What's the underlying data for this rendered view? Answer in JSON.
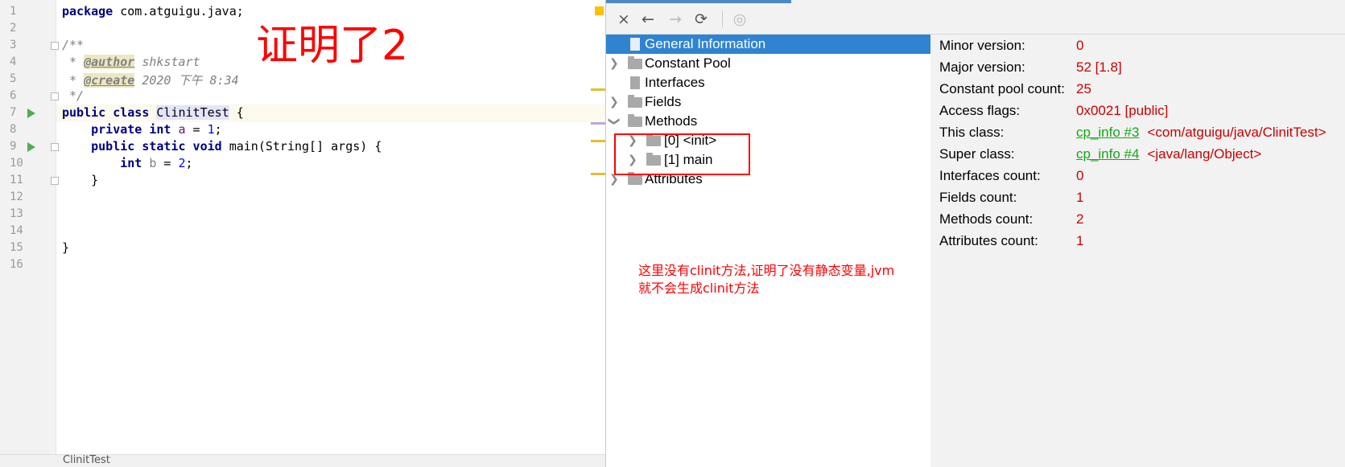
{
  "editor": {
    "overlay_title": "证明了2",
    "lines": [
      {
        "n": "1"
      },
      {
        "n": "2"
      },
      {
        "n": "3"
      },
      {
        "n": "4"
      },
      {
        "n": "5"
      },
      {
        "n": "6"
      },
      {
        "n": "7"
      },
      {
        "n": "8"
      },
      {
        "n": "9"
      },
      {
        "n": "10"
      },
      {
        "n": "11"
      },
      {
        "n": "12"
      },
      {
        "n": "13"
      },
      {
        "n": "14"
      },
      {
        "n": "15"
      },
      {
        "n": "16"
      }
    ],
    "code": {
      "l1_kw": "package",
      "l1_rest": " com.atguigu.java;",
      "l3": "/**",
      "l4_pre": " * ",
      "l4_tag": "@author",
      "l4_val": " shkstart",
      "l5_pre": " * ",
      "l5_tag": "@create",
      "l5_val": " 2020 下午 8:34",
      "l6": " */",
      "l7_kw": "public class ",
      "l7_name": "ClinitTest",
      "l7_rest": " {",
      "l8_kw": "    private int ",
      "l8_var": "a",
      "l8_eq": " = ",
      "l8_num": "1",
      "l8_end": ";",
      "l9_kw": "    public static void ",
      "l9_rest": "main(String[] args) {",
      "l10_kw": "        int ",
      "l10_var": "b",
      "l10_eq": " = ",
      "l10_num": "2",
      "l10_end": ";",
      "l11": "    }",
      "l15": "}"
    },
    "breadcrumb": "ClinitTest"
  },
  "viewer": {
    "toolbar": {
      "close_icon": "×",
      "back_icon": "←",
      "forward_icon": "→",
      "refresh_icon": "⟳",
      "globe_icon": "◎"
    },
    "tree": [
      {
        "label": "General Information"
      },
      {
        "label": "Constant Pool"
      },
      {
        "label": "Interfaces"
      },
      {
        "label": "Fields"
      },
      {
        "label": "Methods"
      },
      {
        "label": "[0] <init>"
      },
      {
        "label": "[1] main"
      },
      {
        "label": "Attributes"
      }
    ],
    "note": "这里没有clinit方法,证明了没有静态变量,jvm就不会生成clinit方法",
    "info": [
      {
        "label": "Minor version:",
        "value": "0"
      },
      {
        "label": "Major version:",
        "value": "52 [1.8]"
      },
      {
        "label": "Constant pool count:",
        "value": "25"
      },
      {
        "label": "Access flags:",
        "value": "0x0021 [public]"
      },
      {
        "label": "This class:",
        "link": "cp_info #3",
        "value": "<com/atguigu/java/ClinitTest>"
      },
      {
        "label": "Super class:",
        "link": "cp_info #4",
        "value": "<java/lang/Object>"
      },
      {
        "label": "Interfaces count:",
        "value": "0"
      },
      {
        "label": "Fields count:",
        "value": "1"
      },
      {
        "label": "Methods count:",
        "value": "2"
      },
      {
        "label": "Attributes count:",
        "value": "1"
      }
    ]
  }
}
